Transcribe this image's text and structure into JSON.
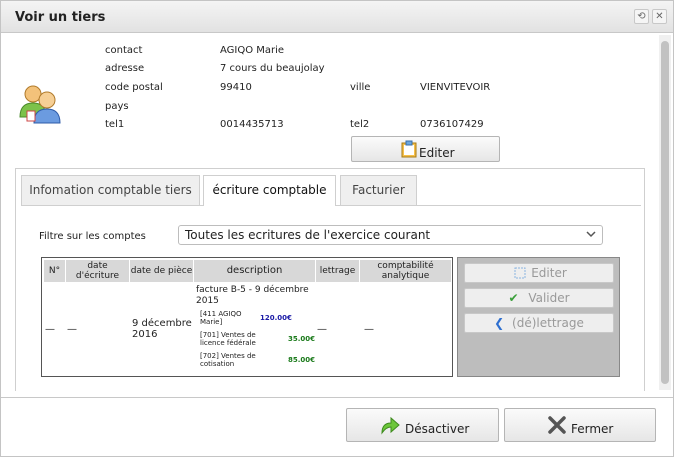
{
  "window": {
    "title": "Voir un tiers"
  },
  "contact": {
    "contact_label": "contact",
    "contact_value": "AGIQO Marie",
    "adresse_label": "adresse",
    "adresse_value": "7 cours du beaujolay",
    "cp_label": "code postal",
    "cp_value": "99410",
    "ville_label": "ville",
    "ville_value": "VIENVITEVOIR",
    "pays_label": "pays",
    "tel1_label": "tel1",
    "tel1_value": "0014435713",
    "tel2_label": "tel2",
    "tel2_value": "0736107429",
    "edit_label": "Editer"
  },
  "tabs": [
    "Infomation comptable tiers",
    "écriture comptable",
    "Facturier"
  ],
  "filter": {
    "label": "Filtre sur les comptes",
    "selected": "Toutes les ecritures de l'exercice courant"
  },
  "table": {
    "headers": [
      "N°",
      "date d'écriture",
      "date de pièce",
      "description",
      "lettrage",
      "comptabilité analytique"
    ],
    "row": {
      "num": "—",
      "date_ecriture": "—",
      "date_piece": "9 décembre 2016",
      "description": "facture B-5 - 9 décembre 2015",
      "lines": [
        {
          "account": "[411 AGIQO Marie]",
          "amount": "120.00€"
        },
        {
          "account": "[701] Ventes de licence fédérale",
          "amount": "35.00€"
        },
        {
          "account": "[702] Ventes de cotisation",
          "amount": "85.00€"
        }
      ],
      "lettrage": "—",
      "analytique": "—"
    }
  },
  "actions": {
    "edit": "Editer",
    "validate": "Valider",
    "letter": "(dé)lettrage"
  },
  "footer": {
    "deactivate": "Désactiver",
    "close": "Fermer"
  },
  "colors": {
    "debit": "#1a1aa6",
    "credit": "#1a7a1a"
  }
}
